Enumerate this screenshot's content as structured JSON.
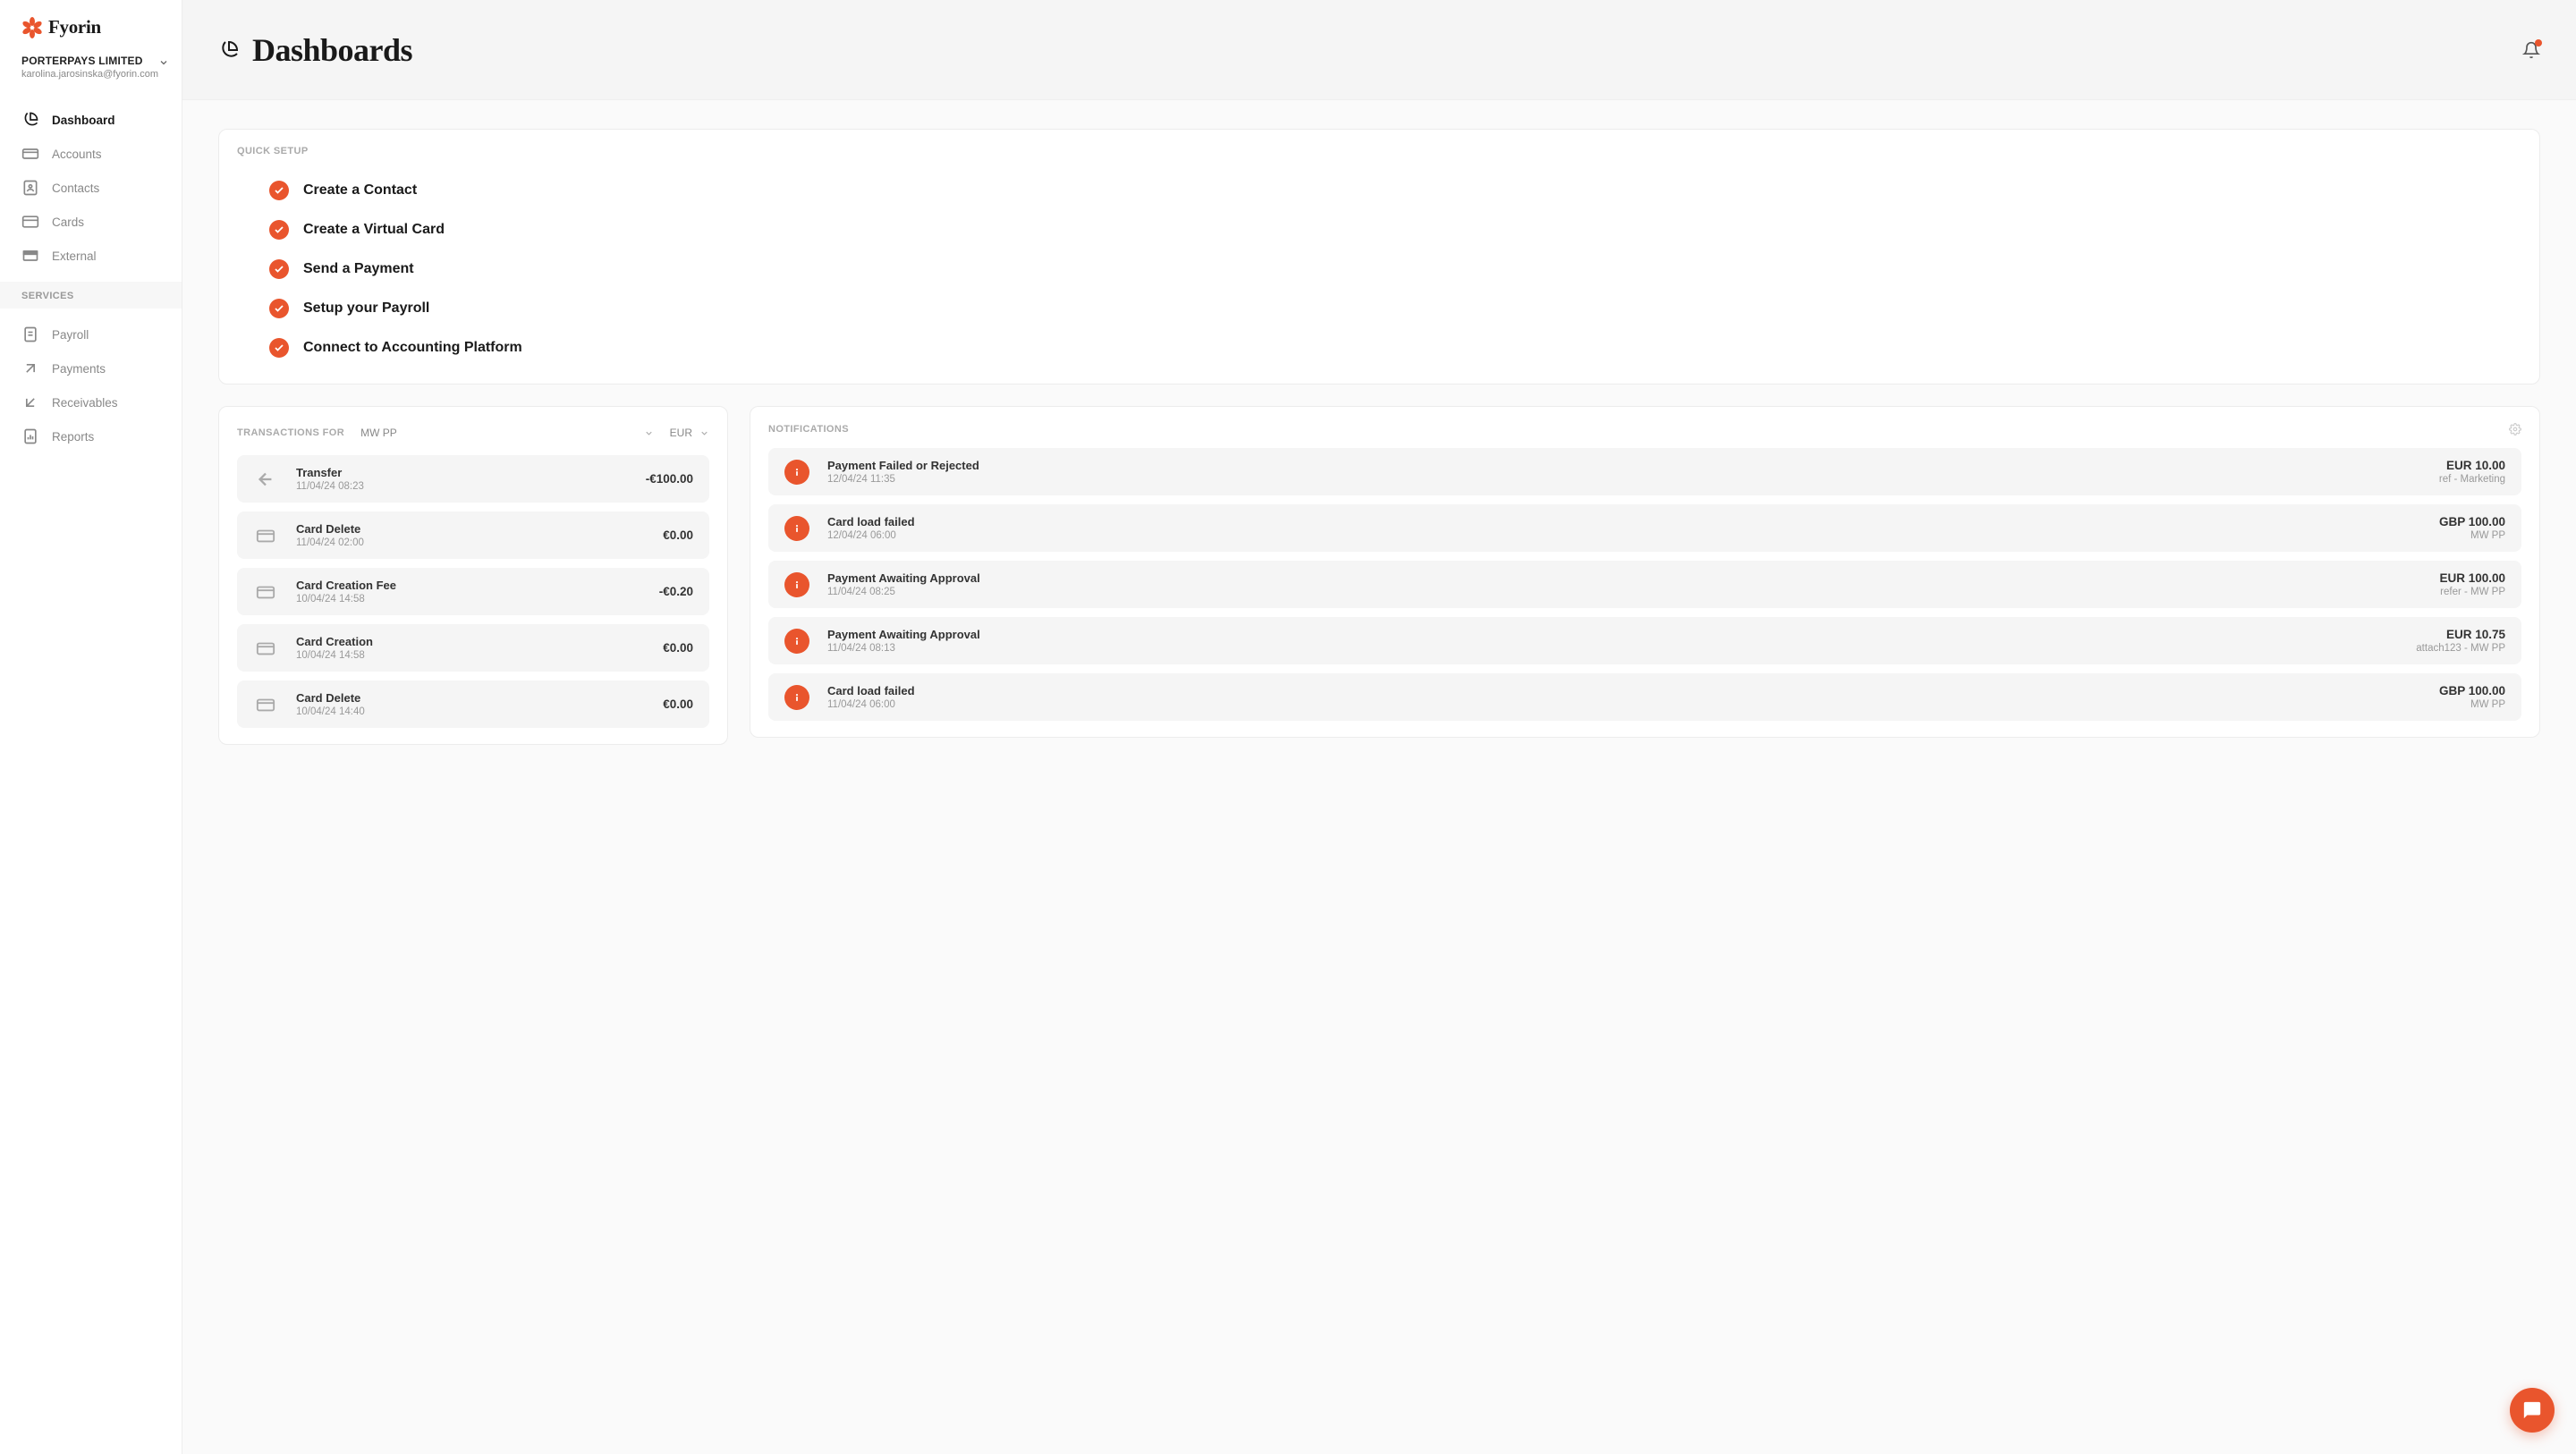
{
  "brand": {
    "name": "Fyorin"
  },
  "org": {
    "name": "PORTERPAYS LIMITED",
    "email": "karolina.jarosinska@fyorin.com"
  },
  "nav_main": [
    {
      "label": "Dashboard",
      "icon": "pie-chart-icon",
      "active": true
    },
    {
      "label": "Accounts",
      "icon": "wallet-icon",
      "active": false
    },
    {
      "label": "Contacts",
      "icon": "address-book-icon",
      "active": false
    },
    {
      "label": "Cards",
      "icon": "credit-card-icon",
      "active": false
    },
    {
      "label": "External",
      "icon": "external-icon",
      "active": false
    }
  ],
  "nav_services_label": "SERVICES",
  "nav_services": [
    {
      "label": "Payroll",
      "icon": "document-icon"
    },
    {
      "label": "Payments",
      "icon": "send-icon"
    },
    {
      "label": "Receivables",
      "icon": "receive-icon"
    },
    {
      "label": "Reports",
      "icon": "report-icon"
    }
  ],
  "page_title": "Dashboards",
  "quick_setup": {
    "label": "QUICK SETUP",
    "items": [
      "Create a Contact",
      "Create a Virtual Card",
      "Send a Payment",
      "Setup your Payroll",
      "Connect to Accounting Platform"
    ]
  },
  "transactions": {
    "label": "TRANSACTIONS FOR",
    "account": "MW PP",
    "currency": "EUR",
    "rows": [
      {
        "icon": "arrow-left-icon",
        "title": "Transfer",
        "sub": "11/04/24 08:23",
        "amount": "-€100.00"
      },
      {
        "icon": "card-icon",
        "title": "Card Delete",
        "sub": "11/04/24 02:00",
        "amount": "€0.00"
      },
      {
        "icon": "card-icon",
        "title": "Card Creation Fee",
        "sub": "10/04/24 14:58",
        "amount": "-€0.20"
      },
      {
        "icon": "card-icon",
        "title": "Card Creation",
        "sub": "10/04/24 14:58",
        "amount": "€0.00"
      },
      {
        "icon": "card-icon",
        "title": "Card Delete",
        "sub": "10/04/24 14:40",
        "amount": "€0.00"
      }
    ]
  },
  "notifications": {
    "label": "NOTIFICATIONS",
    "rows": [
      {
        "title": "Payment Failed or Rejected",
        "sub": "12/04/24 11:35",
        "amount": "EUR 10.00",
        "ref": "ref - Marketing"
      },
      {
        "title": "Card load failed",
        "sub": "12/04/24 06:00",
        "amount": "GBP 100.00",
        "ref": "MW PP"
      },
      {
        "title": "Payment Awaiting Approval",
        "sub": "11/04/24 08:25",
        "amount": "EUR 100.00",
        "ref": "refer - MW PP"
      },
      {
        "title": "Payment Awaiting Approval",
        "sub": "11/04/24 08:13",
        "amount": "EUR 10.75",
        "ref": "attach123 - MW PP"
      },
      {
        "title": "Card load failed",
        "sub": "11/04/24 06:00",
        "amount": "GBP 100.00",
        "ref": "MW PP"
      }
    ]
  }
}
